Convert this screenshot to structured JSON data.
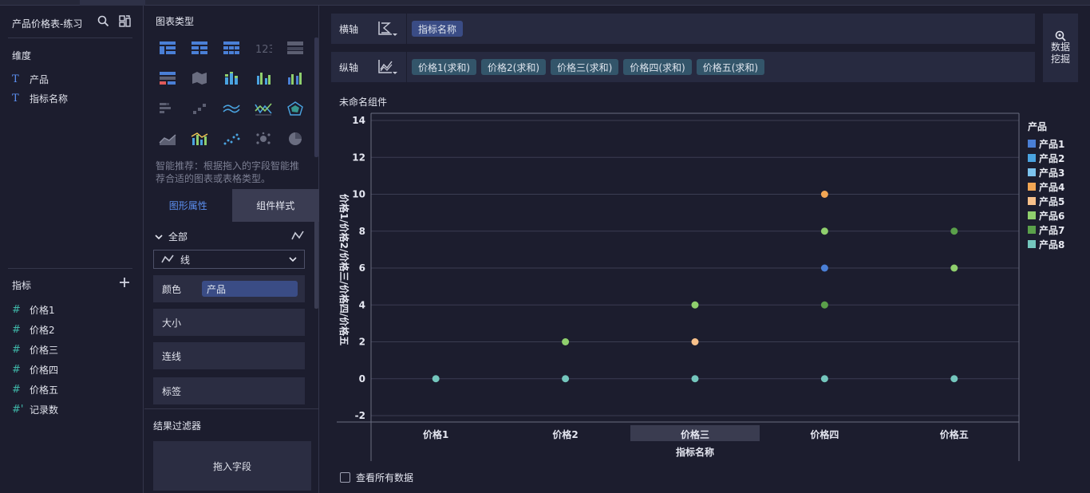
{
  "left": {
    "title": "产品价格表-练习",
    "dimensions_label": "维度",
    "dimensions": [
      {
        "type": "T",
        "label": "产品"
      },
      {
        "type": "T",
        "label": "指标名称"
      }
    ],
    "measures_label": "指标",
    "measures": [
      {
        "type": "#",
        "label": "价格1"
      },
      {
        "type": "#",
        "label": "价格2"
      },
      {
        "type": "#",
        "label": "价格三"
      },
      {
        "type": "#",
        "label": "价格四"
      },
      {
        "type": "#",
        "label": "价格五"
      },
      {
        "type": "#'",
        "label": "记录数"
      }
    ]
  },
  "middle": {
    "chart_type_label": "图表类型",
    "recommend_text": "智能推荐：根据拖入的字段智能推荐合适的图表或表格类型。",
    "tabs": [
      "图形属性",
      "组件样式"
    ],
    "all_label": "全部",
    "mark_type": "线",
    "props": {
      "color": "颜色",
      "color_chip": "产品",
      "size": "大小",
      "line": "连线",
      "label": "标签"
    },
    "filter_label": "结果过滤器",
    "filter_drop": "拖入字段"
  },
  "axes": {
    "x_label": "横轴",
    "x_chips": [
      "指标名称"
    ],
    "y_label": "纵轴",
    "y_chips": [
      "价格1(求和)",
      "价格2(求和)",
      "价格三(求和)",
      "价格四(求和)",
      "价格五(求和)"
    ],
    "mine_line1": "数据",
    "mine_line2": "挖掘"
  },
  "component_title": "未命名组件",
  "view_all_label": "查看所有数据",
  "chart_data": {
    "type": "scatter",
    "categories": [
      "价格1",
      "价格2",
      "价格三",
      "价格四",
      "价格五"
    ],
    "xlabel": "指标名称",
    "ylabel": "价格1/价格2/价格三/价格四/价格五",
    "ylim": [
      -2,
      14
    ],
    "yticks": [
      -2,
      0,
      2,
      4,
      6,
      8,
      10,
      12,
      14
    ],
    "grid": true,
    "highlight_category": "价格三",
    "legend_title": "产品",
    "legend_position": "right",
    "series": [
      {
        "name": "产品1",
        "color": "#4a7fd6",
        "values": [
          null,
          null,
          null,
          6,
          null
        ]
      },
      {
        "name": "产品2",
        "color": "#4aa3e0",
        "values": [
          null,
          null,
          null,
          null,
          null
        ]
      },
      {
        "name": "产品3",
        "color": "#7cc3ee",
        "values": [
          null,
          null,
          null,
          null,
          null
        ]
      },
      {
        "name": "产品4",
        "color": "#f2a654",
        "values": [
          null,
          null,
          null,
          10,
          null
        ]
      },
      {
        "name": "产品5",
        "color": "#f7c08a",
        "values": [
          null,
          null,
          2,
          null,
          null
        ]
      },
      {
        "name": "产品6",
        "color": "#8fcf6d",
        "values": [
          null,
          2,
          4,
          8,
          6
        ]
      },
      {
        "name": "产品7",
        "color": "#5aa04a",
        "values": [
          null,
          null,
          null,
          4,
          8
        ]
      },
      {
        "name": "产品8",
        "color": "#74c6bd",
        "values": [
          0,
          0,
          0,
          0,
          0
        ]
      }
    ]
  }
}
